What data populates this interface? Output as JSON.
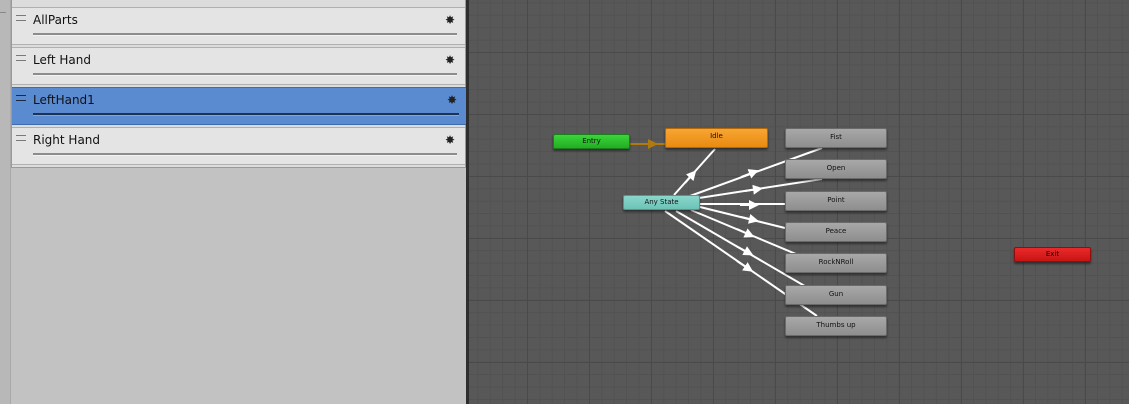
{
  "layers": [
    {
      "name": "AllParts",
      "selected": false
    },
    {
      "name": "Left Hand",
      "selected": false
    },
    {
      "name": "LeftHand1",
      "selected": true
    },
    {
      "name": "Right Hand",
      "selected": false
    }
  ],
  "graph": {
    "states": {
      "entry": "Entry",
      "idle": "Idle",
      "any_state": "Any State",
      "exit": "Exit",
      "fist": "Fist",
      "open": "Open",
      "point": "Point",
      "peace": "Peace",
      "rocknroll": "RockNRoll",
      "gun": "Gun",
      "thumbs_up": "Thumbs up"
    }
  },
  "colors": {
    "selected_layer": "#5a8ad0",
    "entry": "#2ec22e",
    "idle": "#f09a22",
    "any_state": "#7ccdc2",
    "exit": "#d81e1e",
    "default_transition": "#b07a10",
    "transition": "#ffffff"
  },
  "icons": {
    "layer_handle": "drag-handle-icon",
    "layer_settings": "gear-icon"
  }
}
